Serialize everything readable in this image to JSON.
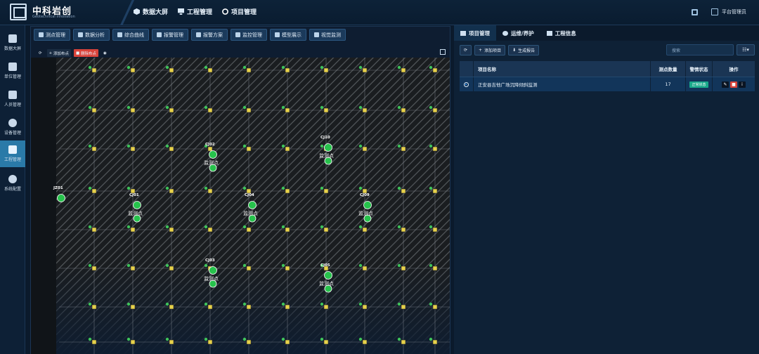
{
  "brand": {
    "title": "中科岩创",
    "subtitle": "Geotechnical Innovation"
  },
  "nav": [
    {
      "label": "数据大屏",
      "icon": "cube-icon"
    },
    {
      "label": "工程管理",
      "icon": "monitor-icon"
    },
    {
      "label": "项目管理",
      "icon": "circle-icon"
    }
  ],
  "user": {
    "label": "平台管理员"
  },
  "sidebar": [
    {
      "label": "数据大屏",
      "icon": "cube-icon"
    },
    {
      "label": "单位管理",
      "icon": "calendar-icon"
    },
    {
      "label": "人员管理",
      "icon": "id-card-icon"
    },
    {
      "label": "设备管理",
      "icon": "gear-icon"
    },
    {
      "label": "工程管理",
      "icon": "chart-icon"
    },
    {
      "label": "系统配置",
      "icon": "dots-icon"
    }
  ],
  "map_toolbar": [
    "测点管理",
    "数据分析",
    "综合曲线",
    "报警管理",
    "报警方案",
    "监控管理",
    "模型展示",
    "视觉监测"
  ],
  "map_subbar": {
    "add": "添加布点",
    "delete": "删除布点"
  },
  "points": [
    {
      "id": "JZ01",
      "sub": ""
    },
    {
      "id": "CJ01",
      "sub": "监测点"
    },
    {
      "id": "CJ02",
      "sub": "监测点"
    },
    {
      "id": "CJ03",
      "sub": "监测点"
    },
    {
      "id": "CJ04",
      "sub": "监测点"
    },
    {
      "id": "CJ05",
      "sub": "监测点"
    },
    {
      "id": "CJ09",
      "sub": "监测点"
    },
    {
      "id": "CJ10",
      "sub": "监测点"
    }
  ],
  "right_tabs": [
    {
      "label": "项目管理",
      "icon": "list-icon"
    },
    {
      "label": "运维/养护",
      "icon": "gear-icon"
    },
    {
      "label": "工程信息",
      "icon": "cubes-icon"
    }
  ],
  "right_toolbar": {
    "add": "添加项目",
    "report": "生成报告"
  },
  "search": {
    "placeholder": "搜索"
  },
  "table": {
    "headers": [
      "项目名称",
      "测点数量",
      "警情状态",
      "操作"
    ],
    "rows": [
      {
        "name": "正安县吉他广场沉降倾斜监测",
        "count": "17",
        "status": "正常状态",
        "status_color": "#18a88a"
      }
    ]
  }
}
